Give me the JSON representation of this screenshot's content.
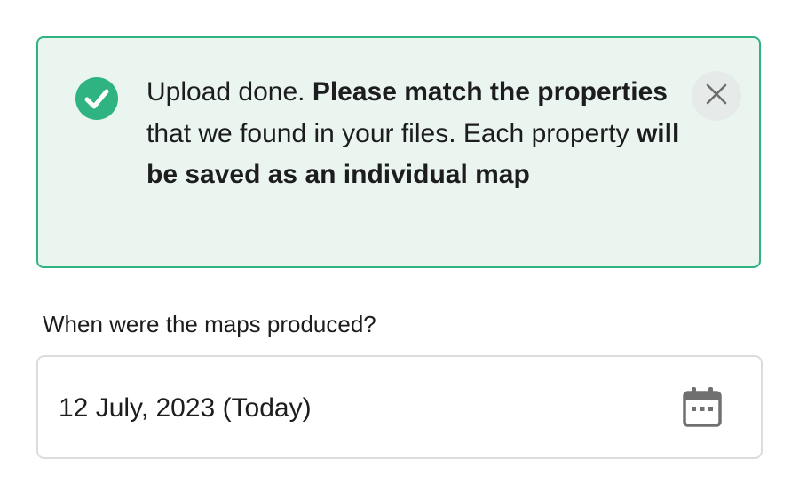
{
  "alert": {
    "text_parts": [
      {
        "text": "Upload done. ",
        "bold": false
      },
      {
        "text": "Please match the properties",
        "bold": true
      },
      {
        "text": " that we found in your files. Each property ",
        "bold": false
      },
      {
        "text": "will be saved as an individual map",
        "bold": true
      }
    ],
    "status_icon": "check-circle-icon",
    "close_icon": "close-icon",
    "accent_color": "#2fb380",
    "background_color": "#eaf5f0"
  },
  "date_question": {
    "label": "When were the maps produced?",
    "value": "12 July, 2023 (Today)",
    "icon": "calendar-icon"
  }
}
